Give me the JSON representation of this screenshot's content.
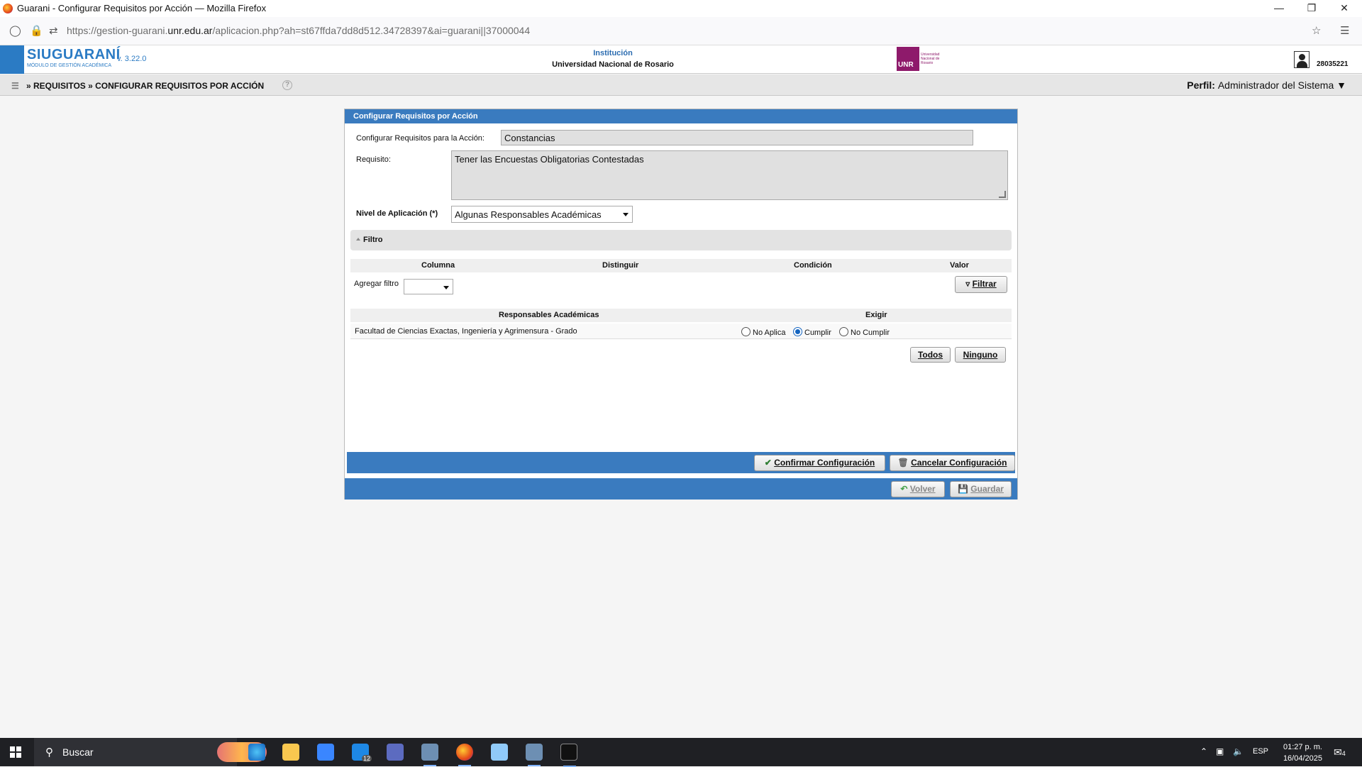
{
  "browser": {
    "window_title": "Guarani - Configurar Requisitos por Acción — Mozilla Firefox",
    "url_prefix": "https://gestion-guarani.",
    "url_domain": "unr.edu.ar",
    "url_path": "/aplicacion.php?ah=st67ffda7dd8d512.34728397&ai=guarani||37000044"
  },
  "header": {
    "logo_text": "SIUGUARANÍ",
    "logo_sub": "Módulo de Gestión Académica",
    "version": "v. 3.22.0",
    "institution_label": "Institución",
    "institution_name": "Universidad Nacional de Rosario",
    "unr_logo_text": "UNR",
    "unr_logo_lines": "Universidad Nacional de Rosario",
    "user_id": "28035221"
  },
  "breadcrumb": {
    "text": "» REQUISITOS » CONFIGURAR REQUISITOS POR ACCIÓN",
    "help": "?",
    "perfil_label": "Perfil:",
    "perfil_value": "Administrador del Sistema"
  },
  "form": {
    "title": "Configurar Requisitos por Acción",
    "accion_label": "Configurar Requisitos para la Acción:",
    "accion_value": "Constancias",
    "requisito_label": "Requisito:",
    "requisito_value": "Tener las Encuestas Obligatorias Contestadas",
    "nivel_label": "Nivel de Aplicación (*)",
    "nivel_value": "Algunas Responsables Académicas",
    "filtro_title": "Filtro",
    "filtro_columns": [
      "Columna",
      "Distinguir",
      "Condición",
      "Valor"
    ],
    "agregar_filtro_label": "Agregar filtro",
    "filtrar_button": "Filtrar",
    "resp_columns": [
      "Responsables Académicas",
      "Exigir"
    ],
    "resp_rows": [
      {
        "name": "Facultad de Ciencias Exactas, Ingeniería y Agrimensura - Grado",
        "options": [
          "No Aplica",
          "Cumplir",
          "No Cumplir"
        ],
        "selected": "Cumplir"
      }
    ],
    "todos_button": "Todos",
    "ninguno_button": "Ninguno",
    "confirmar_button": "Confirmar Configuración",
    "cancelar_button": "Cancelar Configuración",
    "volver_button": "Volver",
    "guardar_button": "Guardar"
  },
  "taskbar": {
    "search_label": "Buscar",
    "mail_badge": "12",
    "language": "ESP",
    "time": "01:27 p. m.",
    "date": "16/04/2025",
    "notification_count": "4"
  },
  "colors": {
    "accent": "#3a7bbf",
    "logo_blue": "#2b7bc4",
    "unr_purple": "#8e1a6b"
  }
}
